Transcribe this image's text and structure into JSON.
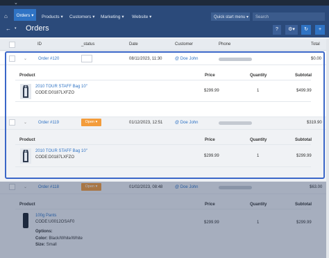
{
  "navbar": {
    "items": [
      "Orders",
      "Products",
      "Customers",
      "Marketing",
      "Website"
    ],
    "quick_start": "Quick start menu",
    "search_placeholder": "Search"
  },
  "page": {
    "title": "Orders"
  },
  "table": {
    "headers": {
      "id": "ID",
      "status": "_status",
      "date": "Date",
      "customer": "Customer",
      "phone": "Phone",
      "total": "Total"
    },
    "orders": [
      {
        "id": "Order #120",
        "status": "",
        "date": "08/11/2023, 11:30",
        "customer": "Doe John",
        "total": "$0.00",
        "sub_headers": {
          "product": "Product",
          "price": "Price",
          "quantity": "Quantity",
          "subtotal": "Subtotal"
        },
        "items": [
          {
            "name": "2010 TOUR STAFF Bag 10\"",
            "code": "CODE:D0187LXFZO",
            "price": "$299.99",
            "quantity": "1",
            "subtotal": "$499.99"
          }
        ]
      },
      {
        "id": "Order #119",
        "status": "Open",
        "date": "01/12/2023, 12:51",
        "customer": "Doe John",
        "total": "$319.90",
        "sub_headers": {
          "product": "Product",
          "price": "Price",
          "quantity": "Quantity",
          "subtotal": "Subtotal"
        },
        "items": [
          {
            "name": "2010 TOUR STAFF Bag 10\"",
            "code": "CODE:D0187LXFZO",
            "price": "$299.99",
            "quantity": "1",
            "subtotal": "$299.99"
          }
        ]
      },
      {
        "id": "Order #118",
        "status": "Open",
        "date": "01/02/2023, 08:48",
        "customer": "Doe John",
        "total": "$63.00",
        "sub_headers": {
          "product": "Product",
          "price": "Price",
          "quantity": "Quantity",
          "subtotal": "Subtotal"
        },
        "items": [
          {
            "name": "100g Pants",
            "code": "CODE:U0012OSAF0",
            "price": "$299.99",
            "quantity": "1",
            "subtotal": "$299.99",
            "options": "Options:",
            "color_label": "Color:",
            "color": "Black/White/White",
            "size_label": "Size:",
            "size": "Small"
          }
        ]
      }
    ]
  }
}
